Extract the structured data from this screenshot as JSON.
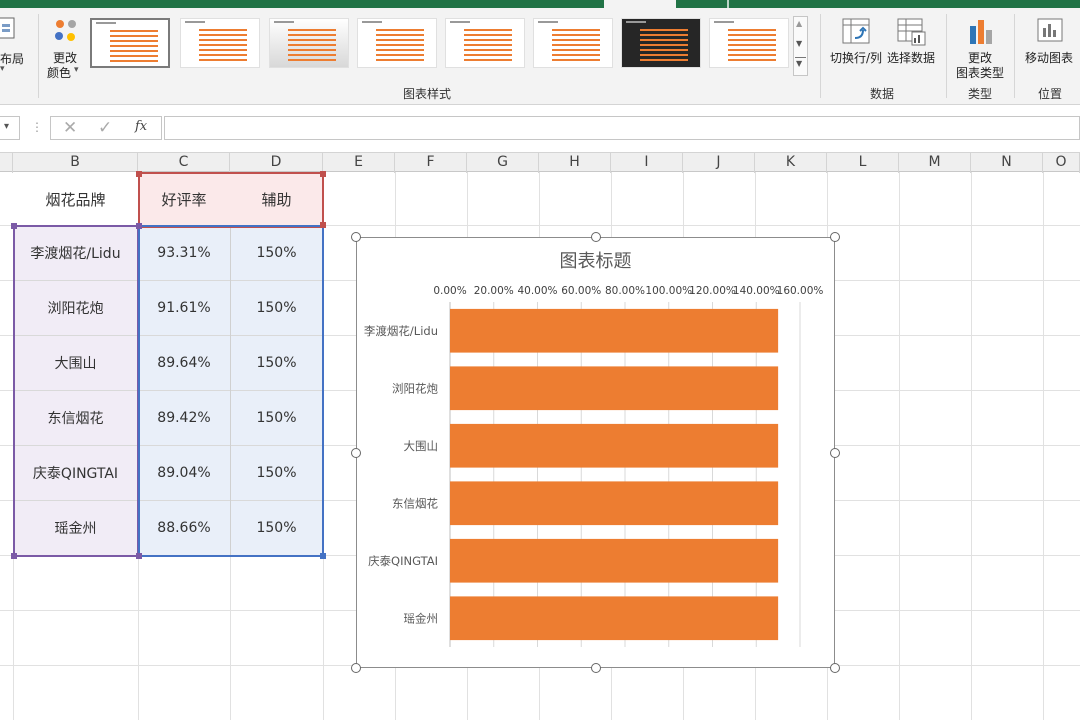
{
  "ribbon": {
    "layout_label": "布局",
    "color_btn": {
      "line1": "更改",
      "line2": "颜色"
    },
    "styles_group_label": "图表样式",
    "switch_row_col_label": "切换行/列",
    "select_data_label": "选择数据",
    "data_group_label": "数据",
    "change_type": {
      "line1": "更改",
      "line2": "图表类型"
    },
    "type_group_label": "类型",
    "move_chart_label": "移动图表",
    "position_group_label": "位置"
  },
  "formula_bar": {
    "fx": "fx",
    "value": ""
  },
  "columns": [
    "B",
    "C",
    "D",
    "E",
    "F",
    "G",
    "H",
    "I",
    "J",
    "K",
    "L",
    "M",
    "N",
    "O"
  ],
  "table": {
    "headers": [
      "烟花品牌",
      "好评率",
      "辅助"
    ],
    "rows": [
      [
        "李渡烟花/Lidu",
        "93.31%",
        "150%"
      ],
      [
        "浏阳花炮",
        "91.61%",
        "150%"
      ],
      [
        "大围山",
        "89.64%",
        "150%"
      ],
      [
        "东信烟花",
        "89.42%",
        "150%"
      ],
      [
        "庆泰QINGTAI",
        "89.04%",
        "150%"
      ],
      [
        "瑶金州",
        "88.66%",
        "150%"
      ]
    ]
  },
  "chart_data": {
    "type": "bar",
    "title": "图表标题",
    "categories": [
      "李渡烟花/Lidu",
      "浏阳花炮",
      "大围山",
      "东信烟花",
      "庆泰QINGTAI",
      "瑶金州"
    ],
    "series": [
      {
        "values": [
          1.5,
          1.5,
          1.5,
          1.5,
          1.5,
          1.5
        ]
      }
    ],
    "xlim": [
      0,
      1.6
    ],
    "xticks": [
      "0.00%",
      "20.00%",
      "40.00%",
      "60.00%",
      "80.00%",
      "100.00%",
      "120.00%",
      "140.00%",
      "160.00%"
    ],
    "x_axis_position": "top",
    "orientation": "horizontal",
    "grid": true,
    "legend": "none",
    "bar_color": "#ed7d31"
  },
  "colors": {
    "accent_green": "#217346",
    "bar": "#ed7d31",
    "header_fill": "#fbe9ea",
    "data_fill": "#e9eff9",
    "name_fill": "#f1ecf6"
  }
}
